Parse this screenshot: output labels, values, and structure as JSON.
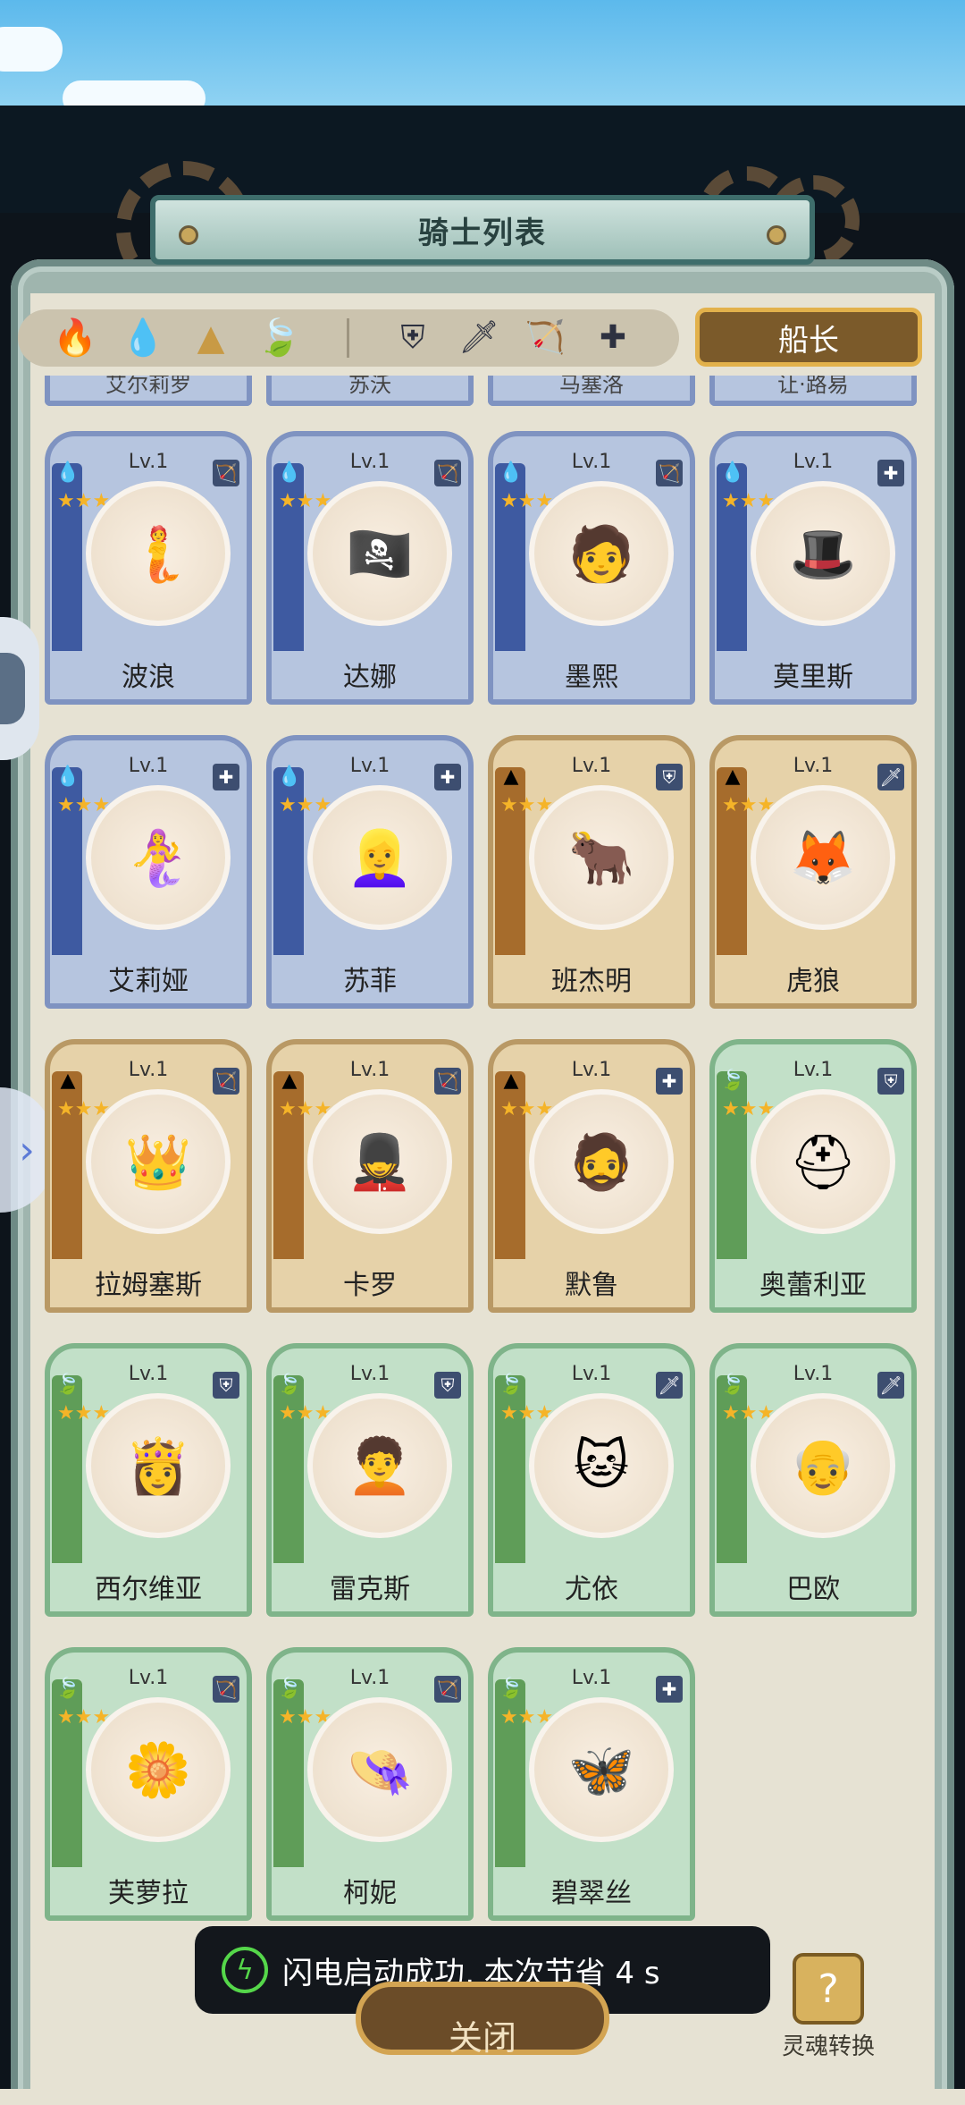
{
  "header": {
    "title": "骑士列表"
  },
  "filters": {
    "elements": [
      {
        "name": "fire-element-icon",
        "glyph": "🔥",
        "color": "#c9453b"
      },
      {
        "name": "water-element-icon",
        "glyph": "💧",
        "color": "#4a75c7"
      },
      {
        "name": "earth-element-icon",
        "glyph": "▲",
        "color": "#c89a45"
      },
      {
        "name": "wind-element-icon",
        "glyph": "🍃",
        "color": "#6fb14c"
      }
    ],
    "roles": [
      {
        "name": "shield-role-icon",
        "glyph": "⛨"
      },
      {
        "name": "sword-role-icon",
        "glyph": "🗡"
      },
      {
        "name": "bow-role-icon",
        "glyph": "🏹"
      },
      {
        "name": "healer-role-icon",
        "glyph": "✚"
      }
    ],
    "captain_label": "船长"
  },
  "partial_row": [
    "艾尔莉罗",
    "苏沃",
    "马塞洛",
    "让·路易"
  ],
  "knights": [
    {
      "name": "波浪",
      "level": "Lv.1",
      "element": "water",
      "role": "🏹",
      "stars": 3,
      "face": "🧜"
    },
    {
      "name": "达娜",
      "level": "Lv.1",
      "element": "water",
      "role": "🏹",
      "stars": 3,
      "face": "🏴‍☠️"
    },
    {
      "name": "墨熙",
      "level": "Lv.1",
      "element": "water",
      "role": "🏹",
      "stars": 3,
      "face": "🧑"
    },
    {
      "name": "莫里斯",
      "level": "Lv.1",
      "element": "water",
      "role": "✚",
      "stars": 3,
      "face": "🎩"
    },
    {
      "name": "艾莉娅",
      "level": "Lv.1",
      "element": "water",
      "role": "✚",
      "stars": 3,
      "face": "🧜‍♀️"
    },
    {
      "name": "苏菲",
      "level": "Lv.1",
      "element": "water",
      "role": "✚",
      "stars": 3,
      "face": "👱‍♀️"
    },
    {
      "name": "班杰明",
      "level": "Lv.1",
      "element": "earth",
      "role": "⛨",
      "stars": 3,
      "face": "🐂"
    },
    {
      "name": "虎狼",
      "level": "Lv.1",
      "element": "earth",
      "role": "🗡",
      "stars": 3,
      "face": "🦊"
    },
    {
      "name": "拉姆塞斯",
      "level": "Lv.1",
      "element": "earth",
      "role": "🏹",
      "stars": 3,
      "face": "👑"
    },
    {
      "name": "卡罗",
      "level": "Lv.1",
      "element": "earth",
      "role": "🏹",
      "stars": 3,
      "face": "💂"
    },
    {
      "name": "默鲁",
      "level": "Lv.1",
      "element": "earth",
      "role": "✚",
      "stars": 3,
      "face": "🧔"
    },
    {
      "name": "奥蕾利亚",
      "level": "Lv.1",
      "element": "wind",
      "role": "⛨",
      "stars": 3,
      "face": "⛑"
    },
    {
      "name": "西尔维亚",
      "level": "Lv.1",
      "element": "wind",
      "role": "⛨",
      "stars": 3,
      "face": "👸"
    },
    {
      "name": "雷克斯",
      "level": "Lv.1",
      "element": "wind",
      "role": "⛨",
      "stars": 3,
      "face": "🧑‍🦱"
    },
    {
      "name": "尤依",
      "level": "Lv.1",
      "element": "wind",
      "role": "🗡",
      "stars": 3,
      "face": "🐱"
    },
    {
      "name": "巴欧",
      "level": "Lv.1",
      "element": "wind",
      "role": "🗡",
      "stars": 3,
      "face": "👴"
    },
    {
      "name": "芙萝拉",
      "level": "Lv.1",
      "element": "wind",
      "role": "🏹",
      "stars": 3,
      "face": "🌼"
    },
    {
      "name": "柯妮",
      "level": "Lv.1",
      "element": "wind",
      "role": "🏹",
      "stars": 3,
      "face": "👒"
    },
    {
      "name": "碧翠丝",
      "level": "Lv.1",
      "element": "wind",
      "role": "✚",
      "stars": 3,
      "face": "🦋"
    }
  ],
  "element_glyphs": {
    "water": "💧",
    "earth": "▲",
    "wind": "🍃"
  },
  "toast": {
    "text": "闪电启动成功, 本次节省 4 s"
  },
  "close_label": "关闭",
  "soul_label": "灵魂转换"
}
